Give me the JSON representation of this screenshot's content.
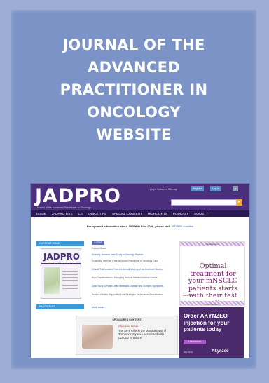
{
  "poster": {
    "title_lines": [
      "JOURNAL OF THE",
      "ADVANCED",
      "PRACTITIONER IN",
      "ONCOLOGY",
      "WEBSITE"
    ]
  },
  "site": {
    "logo": "JADPRO",
    "logo_sub": "Journal of the Advanced Practitioner in Oncology",
    "top_links": "Log in   Subscribe   Sitemap",
    "top_btn_1": "Register",
    "top_btn_2": "Log In",
    "nav": [
      "ISSUE",
      "JADPRO LIVE",
      "CE",
      "QUICK TIPS",
      "SPECIAL CONTENT",
      "HIGHLIGHTS",
      "PODCAST",
      "SOCIETY"
    ],
    "notice_bold": "For updated information about JADPRO Live 2020, please visit",
    "notice_link": "JADPRO.com/live",
    "current_issue_tab": "CURRENT ISSUE",
    "cover_logo": "JADPRO",
    "past_issues_tab": "PAST ISSUES",
    "issue_badge": "IN THIS ISSUE",
    "articles": [
      "Editorial Board",
      "Diversity, Inclusion, and Equity in Oncology Practice",
      "Expanding the Role of the Advanced Practitioner in Oncology Care",
      "Clinical Trial Updates From the Annual Meeting of the American Society",
      "Key Considerations in Managing Immune-Related Adverse Events",
      "Case Study: A Patient With Metastatic Disease and Complex Symptoms",
      "Practice Review: Supportive Care Strategies for Advanced Practitioners"
    ],
    "more_link": "More Issues",
    "sponsored_label": "SPONSORED CONTENT",
    "sponsored_caption": "A Sponsored Feature",
    "sponsored_title": "The AP's Role in the Management of Thrombocytopenia Associated with CDK4/6 Inhibitors",
    "ad1_label": "Advertisement",
    "ad1_headline": "Optimal treatment for your mNSCLC patients starts with their test results.",
    "ad1_footer": "AstraZeneca",
    "ad2_label": "Advertisement",
    "ad2_headline": "Order AKYNZEO injection for your patients today",
    "ad2_button": "Learn more",
    "ad2_brand": "Akynzeo",
    "ad2_sub": "HELSINN"
  }
}
